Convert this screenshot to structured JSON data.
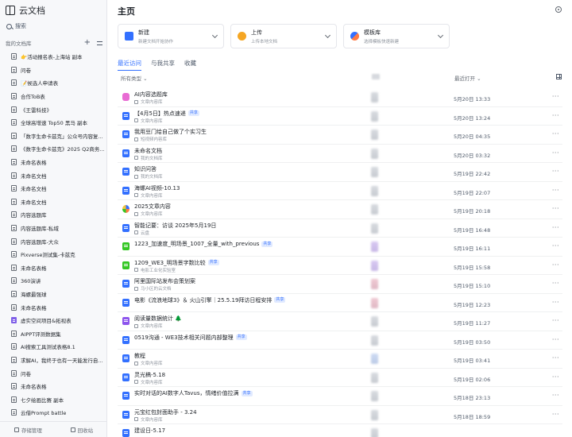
{
  "sidebar": {
    "app_title": "云文档",
    "search_label": "搜索",
    "kb_label": "我的文档库",
    "items": [
      {
        "label": "👉活动报名表-上海站 副本",
        "icon": "doc-icon"
      },
      {
        "label": "问卷",
        "icon": "doc-icon"
      },
      {
        "label": "📝候选人申请表",
        "icon": "doc-icon"
      },
      {
        "label": "合作ToB表",
        "icon": "doc-icon"
      },
      {
        "label": "《王雷科技》",
        "icon": "doc-icon"
      },
      {
        "label": "全球高增速 Top50 黑马 副本",
        "icon": "doc-icon"
      },
      {
        "label": "「数字生命卡兹克」公众号内容复...",
        "icon": "doc-icon"
      },
      {
        "label": "《数字生命卡兹克》2025 Q2商务...",
        "icon": "doc-icon"
      },
      {
        "label": "未命名表格",
        "icon": "doc-icon"
      },
      {
        "label": "未命名文档",
        "icon": "doc-icon"
      },
      {
        "label": "未命名文档",
        "icon": "doc-icon"
      },
      {
        "label": "未命名文档",
        "icon": "doc-icon"
      },
      {
        "label": "内容选题库",
        "icon": "doc-icon"
      },
      {
        "label": "内容选题库-私域",
        "icon": "doc-icon"
      },
      {
        "label": "内容选题库-大众",
        "icon": "doc-icon"
      },
      {
        "label": "Pixverse测试集-卡兹克",
        "icon": "doc-icon"
      },
      {
        "label": "未命名表格",
        "icon": "doc-icon"
      },
      {
        "label": "360演讲",
        "icon": "doc-icon"
      },
      {
        "label": "海螺最强球",
        "icon": "doc-icon"
      },
      {
        "label": "未命名表格",
        "icon": "doc-icon"
      },
      {
        "label": "虚实空间项目&拓视表",
        "icon": "purple-doc-icon"
      },
      {
        "label": "AIPPT评测数据集",
        "icon": "doc-icon"
      },
      {
        "label": "AI搜索工具测试表格8.1",
        "icon": "doc-icon"
      },
      {
        "label": "求解AI，我终于也有一天能发行自...",
        "icon": "doc-icon"
      },
      {
        "label": "问卷",
        "icon": "doc-icon"
      },
      {
        "label": "未命名表格",
        "icon": "doc-icon"
      },
      {
        "label": "七夕绘画比赛 副本",
        "icon": "doc-icon"
      },
      {
        "label": "云借Prompt battle",
        "icon": "doc-icon"
      }
    ],
    "footer": {
      "storage": "存储管理",
      "trash": "回收站"
    }
  },
  "main": {
    "title": "主页",
    "cards": [
      {
        "title": "新建",
        "sub": "新建文档开始协作",
        "icon": "new-doc-icon"
      },
      {
        "title": "上传",
        "sub": "上传本地文档",
        "icon": "upload-icon"
      },
      {
        "title": "模板库",
        "sub": "选择模板快速新建",
        "icon": "template-icon"
      }
    ],
    "tabs": [
      "最近访问",
      "与我共享",
      "收藏"
    ],
    "columns": {
      "type": "所有类型",
      "opened": "最近打开"
    },
    "rows": [
      {
        "title": "AI内容选题库",
        "tag": "",
        "loc": "文章内容库",
        "date": "5月20日 13:33",
        "icon": "pink",
        "owner": "gray"
      },
      {
        "title": "【4月5日】热点速递",
        "tag": "共享",
        "loc": "文章内容库",
        "date": "5月20日 13:24",
        "icon": "blue",
        "owner": "gray"
      },
      {
        "title": "我用豆门给自己做了个实习生",
        "tag": "",
        "loc": "短视频内容库",
        "date": "5月20日 04:35",
        "icon": "blue",
        "owner": "gray"
      },
      {
        "title": "未命名文档",
        "tag": "",
        "loc": "我的文档库",
        "date": "5月20日 03:32",
        "icon": "blue",
        "owner": "gray"
      },
      {
        "title": "知识问答",
        "tag": "",
        "loc": "我的文档库",
        "date": "5月19日 22:42",
        "icon": "blue",
        "owner": "gray"
      },
      {
        "title": "海螺AI视频-10.13",
        "tag": "",
        "loc": "文章内容库",
        "date": "5月19日 22:07",
        "icon": "blue",
        "owner": "gray"
      },
      {
        "title": "2025文章内容",
        "tag": "",
        "loc": "文章内容库",
        "date": "5月19日 20:18",
        "icon": "multi",
        "owner": "gray"
      },
      {
        "title": "智能记要：访谈 2025年5月19日",
        "tag": "",
        "loc": "云盘",
        "date": "5月19日 16:48",
        "icon": "blue",
        "owner": "gray"
      },
      {
        "title": "1223_加速度_明场景_1007_全量_with_previous",
        "tag": "共享",
        "loc": "",
        "date": "5月19日 16:11",
        "icon": "green",
        "owner": "purple"
      },
      {
        "title": "1209_WE3_明场景字数比较",
        "tag": "共享",
        "loc": "电影工业化实验室",
        "date": "5月19日 15:58",
        "icon": "green",
        "owner": "purple"
      },
      {
        "title": "阿里国际站发布会策划案",
        "tag": "",
        "loc": "马小区的云文档",
        "date": "5月19日 15:10",
        "icon": "blue",
        "owner": "pink"
      },
      {
        "title": "电影《流浪地球3》＆ 火山引擎｜25.5.19拜访日程安排",
        "tag": "共享",
        "loc": "",
        "date": "5月19日 12:23",
        "icon": "blue",
        "owner": "pink"
      },
      {
        "title": "阅读量数据统计 🌲",
        "tag": "",
        "loc": "文章内容库",
        "date": "5月19日 11:27",
        "icon": "purple",
        "owner": "gray"
      },
      {
        "title": "0519沟通 - WE3技术相关问题内部整理",
        "tag": "共享",
        "loc": "",
        "date": "5月19日 03:50",
        "icon": "blue",
        "owner": "gray"
      },
      {
        "title": "教程",
        "tag": "",
        "loc": "文章内容库",
        "date": "5月19日 03:41",
        "icon": "blue",
        "owner": "blue"
      },
      {
        "title": "灵光稿-5.18",
        "tag": "",
        "loc": "文章内容库",
        "date": "5月19日 02:06",
        "icon": "blue",
        "owner": "gray"
      },
      {
        "title": "实时对话的AI数字人Tavus，情绪价值拉满",
        "tag": "共享",
        "loc": "",
        "date": "5月18日 23:13",
        "icon": "blue",
        "owner": "gray"
      },
      {
        "title": "元宝红包封面助手 - 3.24",
        "tag": "",
        "loc": "文章内容库",
        "date": "5月18日 18:59",
        "icon": "blue",
        "owner": "gray"
      },
      {
        "title": "建设日-5.17",
        "tag": "",
        "loc": "",
        "date": "",
        "icon": "blue",
        "owner": "gray"
      }
    ]
  }
}
